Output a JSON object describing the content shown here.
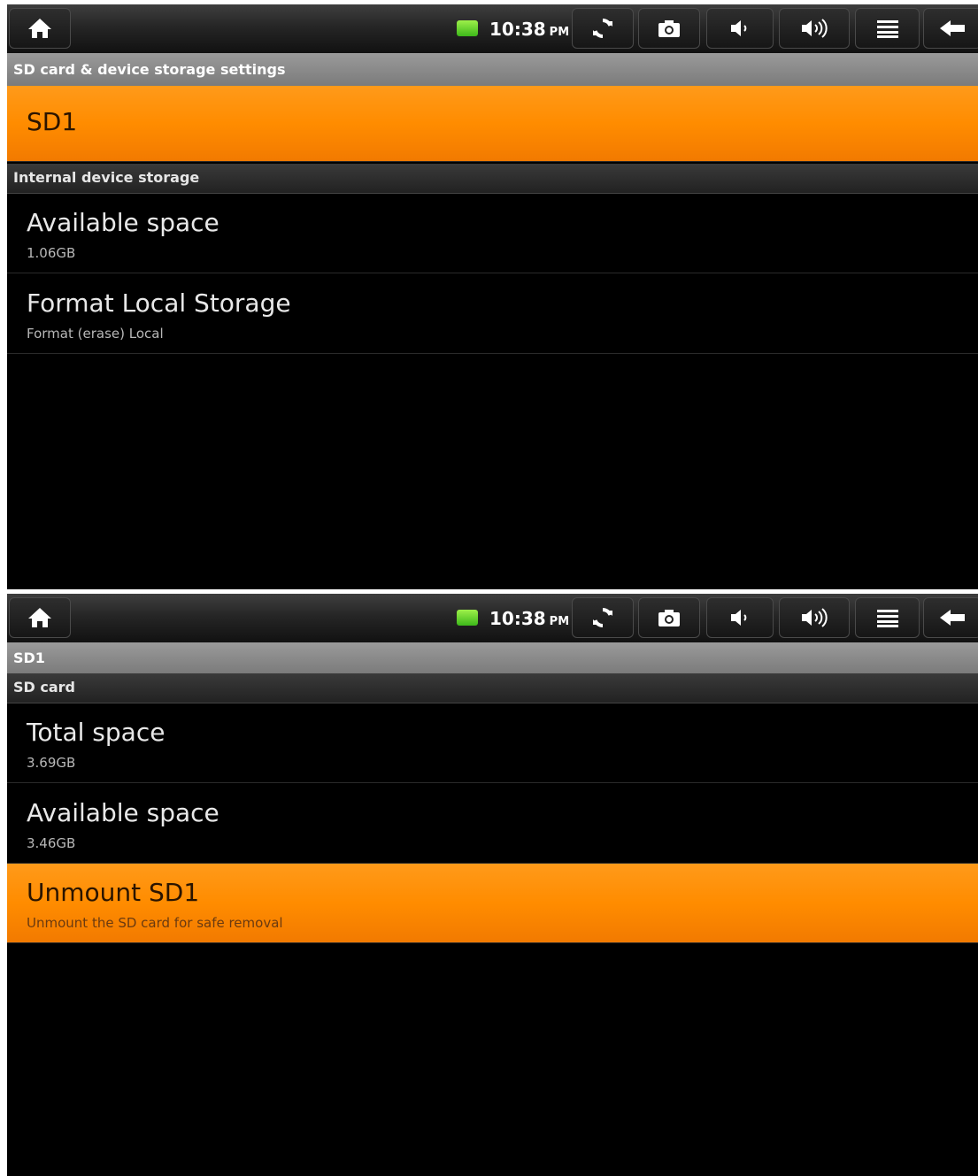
{
  "status_bar": {
    "time": "10:38",
    "ampm": "PM"
  },
  "screen1": {
    "title": "SD card & device storage settings",
    "selected_item": "SD1",
    "category": "Internal device storage",
    "items": [
      {
        "title": "Available space",
        "summary": "1.06GB"
      },
      {
        "title": "Format Local Storage",
        "summary": "Format (erase) Local"
      }
    ]
  },
  "screen2": {
    "title": "SD1",
    "category": "SD card",
    "items": [
      {
        "title": "Total space",
        "summary": "3.69GB"
      },
      {
        "title": "Available space",
        "summary": "3.46GB"
      },
      {
        "title": "Unmount SD1",
        "summary": "Unmount the SD card for safe removal"
      }
    ]
  },
  "colors": {
    "highlight": "#ff8c00",
    "background": "#000000",
    "title_bar": "#8a8a8a"
  }
}
